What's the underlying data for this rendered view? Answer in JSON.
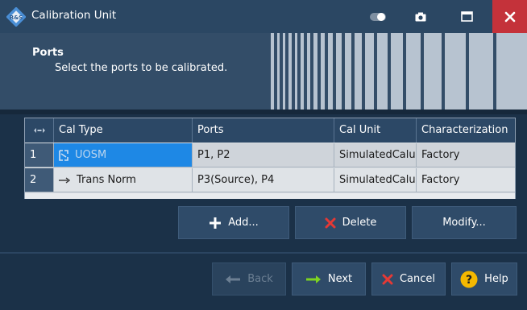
{
  "window": {
    "title": "Calibration Unit"
  },
  "header": {
    "title": "Ports",
    "subtitle": "Select the ports to be calibrated."
  },
  "table": {
    "index_header_icon": "column-resize-arrows-icon",
    "columns": [
      "Cal Type",
      "Ports",
      "Cal Unit",
      "Characterization"
    ],
    "rows": [
      {
        "index": "1",
        "cal_type": "UOSM",
        "type_icon": "uosm-bracket-icon",
        "ports": "P1, P2",
        "cal_unit": "SimulatedCalu",
        "characterization": "Factory",
        "selected": true
      },
      {
        "index": "2",
        "cal_type": "Trans Norm",
        "type_icon": "arrow-right-icon",
        "ports": "P3(Source), P4",
        "cal_unit": "SimulatedCalu",
        "characterization": "Factory",
        "selected": false
      }
    ]
  },
  "actions": {
    "add_label": "Add...",
    "delete_label": "Delete",
    "modify_label": "Modify..."
  },
  "nav": {
    "back_label": "Back",
    "next_label": "Next",
    "cancel_label": "Cancel",
    "help_label": "Help"
  },
  "colors": {
    "accent_selected": "#1e88e5",
    "close_red": "#c4323a",
    "next_arrow_green": "#7ed321",
    "cancel_x_red": "#e53935",
    "help_yellow": "#f5b800"
  }
}
